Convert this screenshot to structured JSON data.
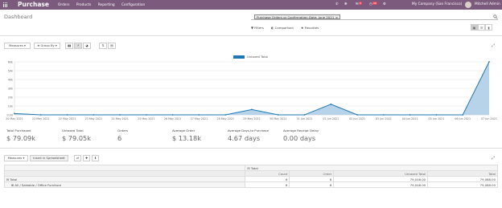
{
  "nav": {
    "brand": "Purchase",
    "menu": [
      "Orders",
      "Products",
      "Reporting",
      "Configuration"
    ],
    "messages_count": "6",
    "activities_count": "26",
    "company": "My Company (San Francisco)",
    "user": "Mitchell Admin"
  },
  "page": {
    "title": "Dashboard",
    "search_facet": "Purchase Orders or Confirmation Date: June 2021",
    "filters_label": "Filters",
    "comparison_label": "Comparison",
    "favorites_label": "Favorites"
  },
  "toolbar": {
    "measures_label": "Measures",
    "group_by_label": "Group By"
  },
  "chart_data": {
    "type": "area",
    "series": [
      {
        "name": "Untaxed Total",
        "values": [
          1500,
          0,
          0,
          0,
          0,
          0,
          0,
          0,
          0,
          6000,
          0,
          0,
          12000,
          0,
          0,
          0,
          0,
          0,
          60000
        ]
      }
    ],
    "categories": [
      "20 May 2021",
      "21 May 2021",
      "22 May 2021",
      "23 May 2021",
      "24 May 2021",
      "25 May 2021",
      "26 May 2021",
      "27 May 2021",
      "28 May 2021",
      "29 May 2021",
      "30 May 2021",
      "31 Jun 2021",
      "01 Jun 2021",
      "02 Jun 2021",
      "03 Jun 2021",
      "04 Jun 2021",
      "05 Jun 2021",
      "06 Jun 2021",
      "07 Jun 2021"
    ],
    "yticks": [
      "0.00",
      "10k",
      "20k",
      "30k",
      "40k",
      "50k",
      "60k"
    ],
    "ylim": [
      0,
      60000
    ],
    "grid": true,
    "legend": "top-center",
    "color": "#1f77b4",
    "fill": "#b7d3e9"
  },
  "kpis": [
    {
      "label": "Total Purchased",
      "value": "$ 79.09k"
    },
    {
      "label": "Untaxed Total",
      "value": "$ 79.05k"
    },
    {
      "label": "Orders",
      "value": "6"
    },
    {
      "label": "Average Order",
      "value": "$ 13.18k"
    },
    {
      "label": "Average Days to Purchase",
      "value": "4.67 days"
    },
    {
      "label": "Average Receipt Delay",
      "value": "0.00 days"
    }
  ],
  "pivot_toolbar": {
    "measures_label": "Measures",
    "insert_label": "Insert in Spreadsheet"
  },
  "pivot": {
    "col_header": "Total",
    "measures": [
      "Count",
      "Order",
      "Untaxed Total",
      "Total"
    ],
    "rows": [
      {
        "label": "Total",
        "values": [
          "6",
          "6",
          "79,046.00",
          "79,088.00"
        ]
      },
      {
        "label": "All / Saleable / Office Furniture",
        "values": [
          "6",
          "6",
          "79,046.00",
          "79,088.00"
        ]
      }
    ]
  }
}
